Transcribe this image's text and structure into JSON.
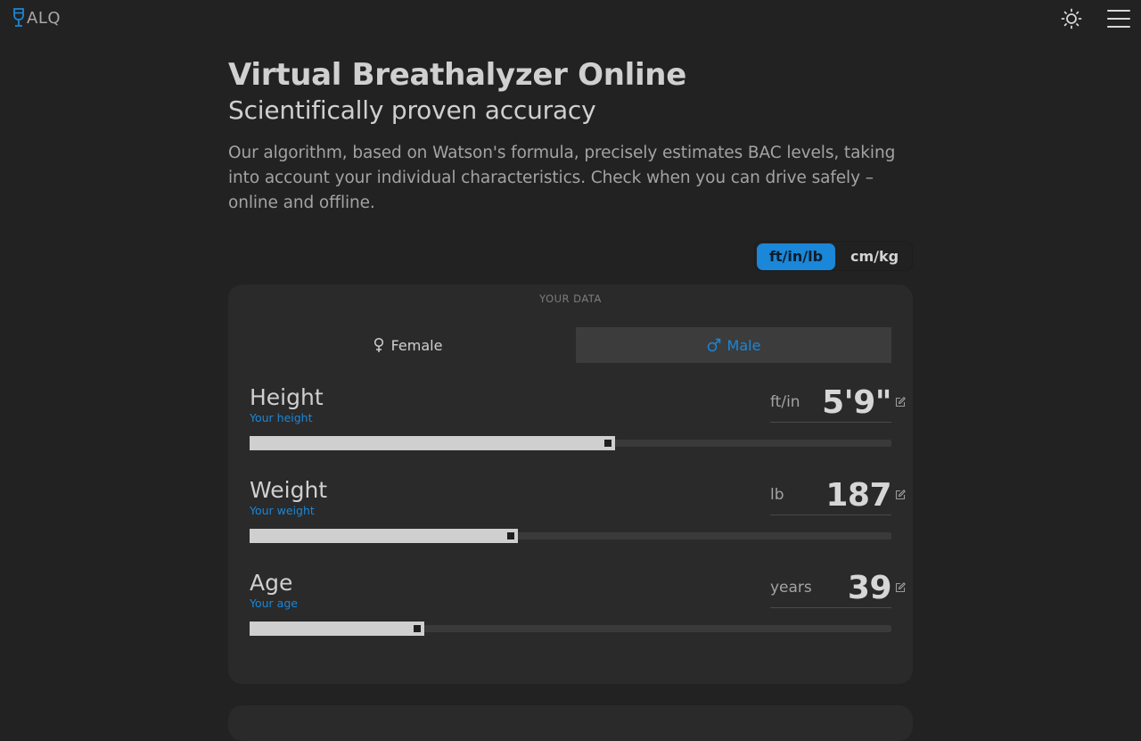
{
  "header": {
    "logo_text": "ALQ",
    "logo_icon": "wine-glass-icon",
    "theme_icon": "sun-icon",
    "menu_icon": "hamburger-menu-icon"
  },
  "hero": {
    "title": "Virtual Breathalyzer Online",
    "subtitle": "Scientifically proven accuracy",
    "description": "Our algorithm, based on Watson's formula, precisely estimates BAC levels, taking into account your individual characteristics. Check when you can drive safely – online and offline."
  },
  "units": {
    "options": [
      "ft/in/lb",
      "cm/kg"
    ],
    "selected": "ft/in/lb"
  },
  "form": {
    "section_title": "YOUR DATA",
    "sex": {
      "female_label": "Female",
      "male_label": "Male",
      "selected": "Male"
    },
    "height": {
      "label": "Height",
      "sublabel": "Your height",
      "unit": "ft/in",
      "value": "5'9\"",
      "slider_fraction": 0.57
    },
    "weight": {
      "label": "Weight",
      "sublabel": "Your weight",
      "unit": "lb",
      "value": "187",
      "slider_fraction": 0.418
    },
    "age": {
      "label": "Age",
      "sublabel": "Your age",
      "unit": "years",
      "value": "39",
      "slider_fraction": 0.272
    }
  },
  "colors": {
    "accent": "#1a87d8",
    "background": "#222222",
    "card": "#2a2a2a"
  }
}
